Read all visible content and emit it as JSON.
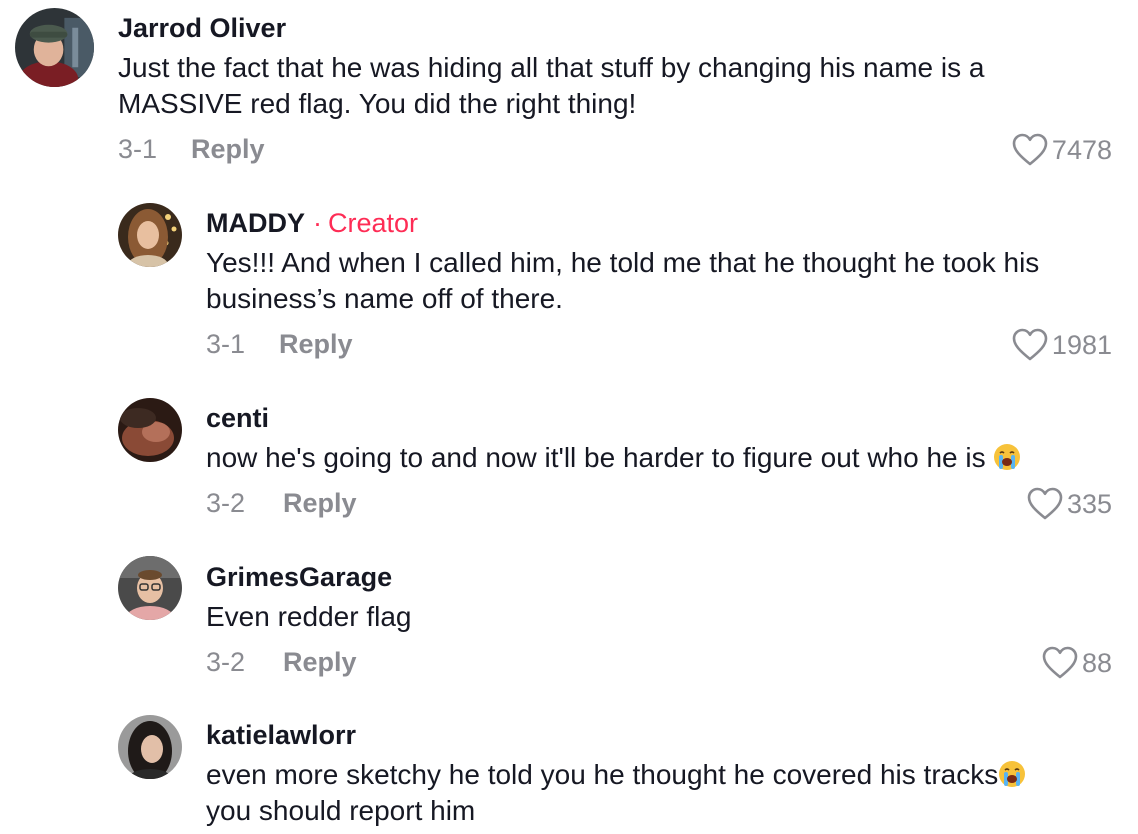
{
  "comments": [
    {
      "username": "Jarrod Oliver",
      "text": "Just the fact that he was hiding all that stuff by changing his name is a\nMASSIVE red flag. You did the right thing!",
      "date": "3-1",
      "reply_label": "Reply",
      "likes": "7478"
    },
    {
      "username": "MADDY",
      "creator_separator": "·",
      "creator_label": "Creator",
      "text": "Yes!!! And when I called him, he told me that he thought he took his\nbusiness’s name off of there.",
      "date": "3-1",
      "reply_label": "Reply",
      "likes": "1981"
    },
    {
      "username": "centi",
      "text": "now he's going to and now it'll be harder to figure out who he is",
      "emoji": "loudly-crying-face",
      "date": "3-2",
      "reply_label": "Reply",
      "likes": "335"
    },
    {
      "username": "GrimesGarage",
      "text": "Even redder flag",
      "date": "3-2",
      "reply_label": "Reply",
      "likes": "88"
    },
    {
      "username": "katielawlorr",
      "text_line1": "even more sketchy he told you he thought he covered his tracks",
      "emoji": "loudly-crying-face",
      "text_line2": "you should report him"
    }
  ],
  "icons": {
    "like": "heart-outline-icon",
    "emoji": "loudly-crying-face-icon"
  },
  "colors": {
    "text": "#161823",
    "muted": "#8a8b91",
    "creator": "#fe2c55"
  }
}
